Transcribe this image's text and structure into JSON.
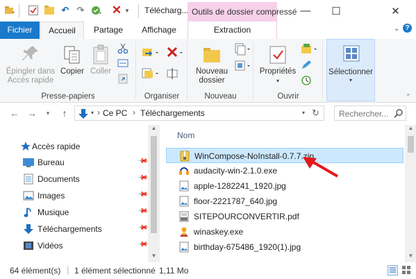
{
  "titlebar": {
    "title": "Télécharg...",
    "contextual_tab_label": "Outils de dossier compressé",
    "minimize": "—",
    "maximize": "☐",
    "close": "✕"
  },
  "ribbon_tabs": {
    "file": "Fichier",
    "home": "Accueil",
    "share": "Partage",
    "view": "Affichage",
    "extract": "Extraction",
    "expand_icon": "chevron-down-icon",
    "help": "?"
  },
  "ribbon": {
    "clipboard": {
      "pin_label": "Épingler dans Accès rapide",
      "copy_label": "Copier",
      "paste_label": "Coller",
      "group_label": "Presse-papiers"
    },
    "organize": {
      "group_label": "Organiser"
    },
    "new": {
      "new_folder_label": "Nouveau dossier",
      "group_label": "Nouveau"
    },
    "open": {
      "properties_label": "Propriétés",
      "group_label": "Ouvrir"
    },
    "select": {
      "select_label": "Sélectionner"
    }
  },
  "address": {
    "path": [
      "Ce PC",
      "Téléchargements"
    ],
    "search_placeholder": "Rechercher..."
  },
  "navpane": {
    "items": [
      {
        "label": "Accès rapide",
        "icon": "star-icon"
      },
      {
        "label": "Bureau",
        "icon": "desktop-icon"
      },
      {
        "label": "Documents",
        "icon": "documents-icon"
      },
      {
        "label": "Images",
        "icon": "images-icon"
      },
      {
        "label": "Musique",
        "icon": "music-icon"
      },
      {
        "label": "Téléchargements",
        "icon": "download-icon"
      },
      {
        "label": "Vidéos",
        "icon": "video-icon"
      }
    ]
  },
  "filelist": {
    "column_name": "Nom",
    "files": [
      {
        "name": "WinCompose-NoInstall-0.7.7.zip",
        "icon": "zip-icon",
        "selected": true
      },
      {
        "name": "audacity-win-2.1.0.exe",
        "icon": "audacity-icon",
        "selected": false
      },
      {
        "name": "apple-1282241_1920.jpg",
        "icon": "image-file-icon",
        "selected": false
      },
      {
        "name": "floor-2221787_640.jpg",
        "icon": "image-file-icon",
        "selected": false
      },
      {
        "name": "SITEPOURCONVERTIR.pdf",
        "icon": "pdf-icon",
        "selected": false
      },
      {
        "name": "winaskey.exe",
        "icon": "exe-icon",
        "selected": false
      },
      {
        "name": "birthday-675486_1920(1).jpg",
        "icon": "image-file-icon",
        "selected": false
      }
    ]
  },
  "status": {
    "count": "64 élément(s)",
    "selection": "1 élément sélectionné",
    "size": "1,11 Mo"
  },
  "colors": {
    "file_tab": "#1979ca",
    "context_tab": "#f7d0ea",
    "selection_bg": "#cce8ff",
    "annotation_arrow": "#e3191b"
  }
}
